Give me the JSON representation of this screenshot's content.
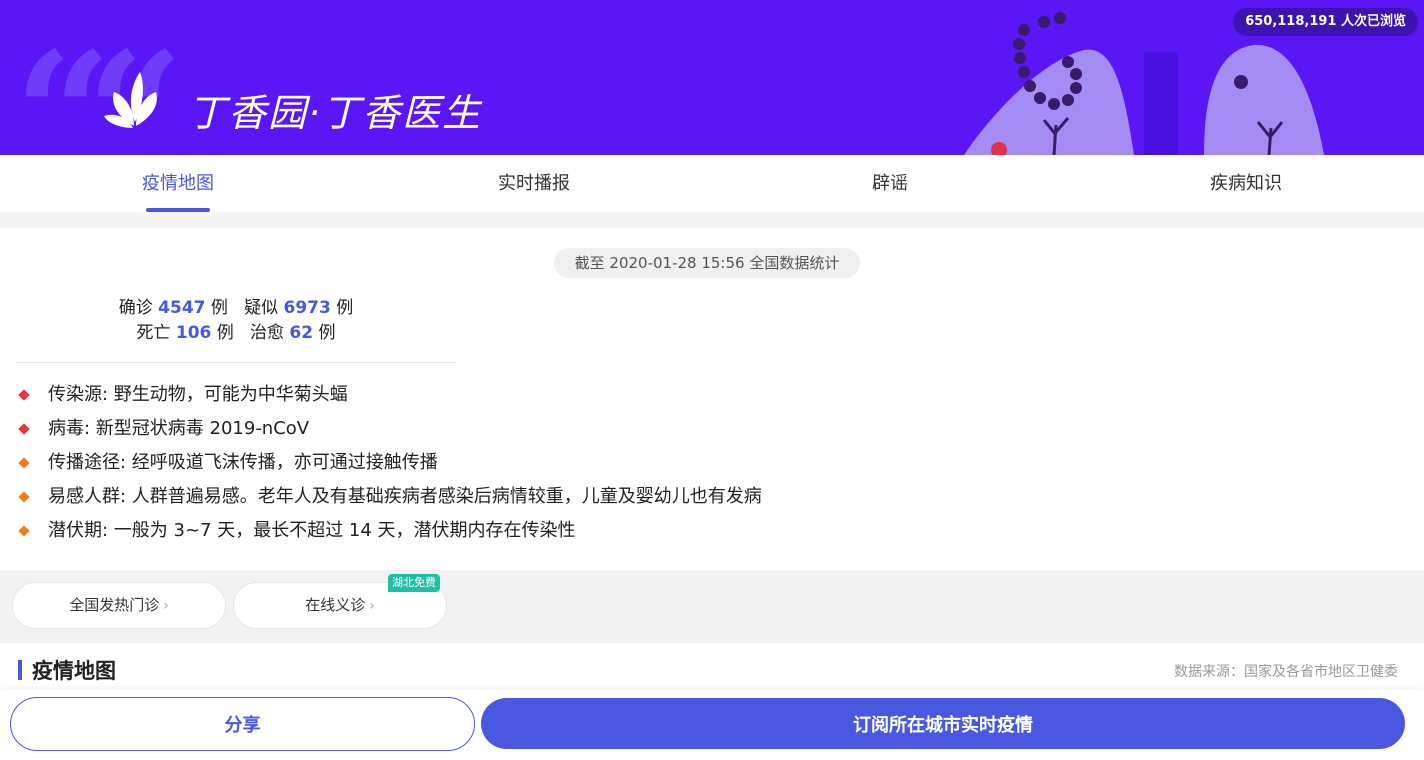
{
  "banner": {
    "logo_text": "丁香园·丁香医生",
    "views": "650,118,191 人次已浏览",
    "colors": {
      "background": "#5a16f5",
      "accent": "#4a57e0"
    }
  },
  "tabs": [
    {
      "label": "疫情地图",
      "active": true
    },
    {
      "label": "实时播报",
      "active": false
    },
    {
      "label": "辟谣",
      "active": false
    },
    {
      "label": "疾病知识",
      "active": false
    }
  ],
  "summary": {
    "timestamp": "截至 2020-01-28 15:56 全国数据统计",
    "confirmed_label": "确诊",
    "confirmed": "4547",
    "suspected_label": "疑似",
    "suspected": "6973",
    "death_label": "死亡",
    "death": "106",
    "cured_label": "治愈",
    "cured": "62",
    "unit": "例"
  },
  "facts": [
    {
      "text": "传染源: 野生动物，可能为中华菊头蝠",
      "color": "#f0313f"
    },
    {
      "text": "病毒: 新型冠状病毒 2019-nCoV",
      "color": "#f0313f"
    },
    {
      "text": "传播途径: 经呼吸道飞沫传播，亦可通过接触传播",
      "color": "#f07e1c"
    },
    {
      "text": "易感人群: 人群普遍易感。老年人及有基础疾病者感染后病情较重，儿童及婴幼儿也有发病",
      "color": "#f07e1c"
    },
    {
      "text": "潜伏期: 一般为 3~7 天，最长不超过 14 天，潜伏期内存在传染性",
      "color": "#f07e1c"
    }
  ],
  "links": {
    "fever_clinic": "全国发热门诊",
    "online_consult": "在线义诊",
    "free_tag": "湖北免费"
  },
  "section": {
    "title": "疫情地图",
    "source": "数据来源：国家及各省市地区卫健委"
  },
  "actions": {
    "share": "分享",
    "subscribe": "订阅所在城市实时疫情"
  }
}
